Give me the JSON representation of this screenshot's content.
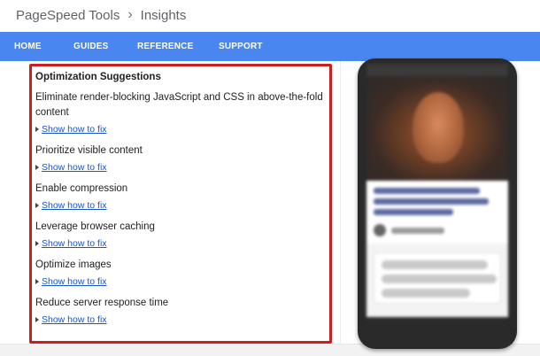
{
  "header": {
    "brand": "PageSpeed Tools",
    "separator": "›",
    "section": "Insights"
  },
  "nav": {
    "items": [
      {
        "label": "HOME"
      },
      {
        "label": "GUIDES"
      },
      {
        "label": "REFERENCE"
      },
      {
        "label": "SUPPORT"
      }
    ]
  },
  "suggestions": {
    "title": "Optimization Suggestions",
    "link_label": "Show how to fix",
    "items": [
      {
        "title": "Eliminate render-blocking JavaScript and CSS in above-the-fold content"
      },
      {
        "title": "Prioritize visible content"
      },
      {
        "title": "Enable compression"
      },
      {
        "title": "Leverage browser caching"
      },
      {
        "title": "Optimize images"
      },
      {
        "title": "Reduce server response time"
      }
    ]
  },
  "colors": {
    "nav_bg": "#4a86f0",
    "highlight_border": "#cc1f1f",
    "link": "#1a55c6"
  }
}
